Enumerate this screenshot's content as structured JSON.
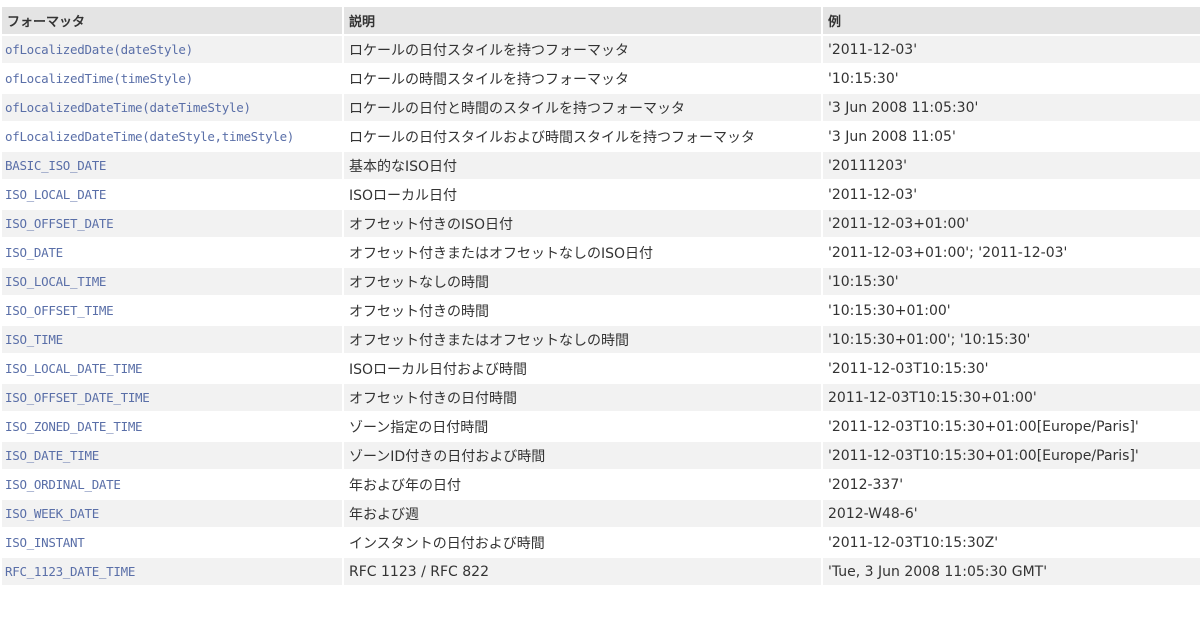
{
  "table": {
    "headers": [
      "フォーマッタ",
      "説明",
      "例"
    ],
    "rows": [
      [
        "ofLocalizedDate(dateStyle)",
        "ロケールの日付スタイルを持つフォーマッタ",
        "'2011-12-03'"
      ],
      [
        "ofLocalizedTime(timeStyle)",
        "ロケールの時間スタイルを持つフォーマッタ",
        "'10:15:30'"
      ],
      [
        "ofLocalizedDateTime(dateTimeStyle)",
        "ロケールの日付と時間のスタイルを持つフォーマッタ",
        "'3 Jun 2008 11:05:30'"
      ],
      [
        "ofLocalizedDateTime(dateStyle,timeStyle)",
        "ロケールの日付スタイルおよび時間スタイルを持つフォーマッタ",
        "'3 Jun 2008 11:05'"
      ],
      [
        "BASIC_ISO_DATE",
        "基本的なISO日付",
        "'20111203'"
      ],
      [
        "ISO_LOCAL_DATE",
        "ISOローカル日付",
        "'2011-12-03'"
      ],
      [
        "ISO_OFFSET_DATE",
        "オフセット付きのISO日付",
        "'2011-12-03+01:00'"
      ],
      [
        "ISO_DATE",
        "オフセット付きまたはオフセットなしのISO日付",
        "'2011-12-03+01:00'; '2011-12-03'"
      ],
      [
        "ISO_LOCAL_TIME",
        "オフセットなしの時間",
        "'10:15:30'"
      ],
      [
        "ISO_OFFSET_TIME",
        "オフセット付きの時間",
        "'10:15:30+01:00'"
      ],
      [
        "ISO_TIME",
        "オフセット付きまたはオフセットなしの時間",
        "'10:15:30+01:00'; '10:15:30'"
      ],
      [
        "ISO_LOCAL_DATE_TIME",
        "ISOローカル日付および時間",
        "'2011-12-03T10:15:30'"
      ],
      [
        "ISO_OFFSET_DATE_TIME",
        "オフセット付きの日付時間",
        "2011-12-03T10:15:30+01:00'"
      ],
      [
        "ISO_ZONED_DATE_TIME",
        "ゾーン指定の日付時間",
        "'2011-12-03T10:15:30+01:00[Europe/Paris]'"
      ],
      [
        "ISO_DATE_TIME",
        "ゾーンID付きの日付および時間",
        "'2011-12-03T10:15:30+01:00[Europe/Paris]'"
      ],
      [
        "ISO_ORDINAL_DATE",
        "年および年の日付",
        "'2012-337'"
      ],
      [
        "ISO_WEEK_DATE",
        "年および週",
        "2012-W48-6'"
      ],
      [
        "ISO_INSTANT",
        "インスタントの日付および時間",
        "'2011-12-03T10:15:30Z'"
      ],
      [
        "RFC_1123_DATE_TIME",
        "RFC 1123 / RFC 822",
        "'Tue, 3 Jun 2008 11:05:30 GMT'"
      ]
    ]
  }
}
